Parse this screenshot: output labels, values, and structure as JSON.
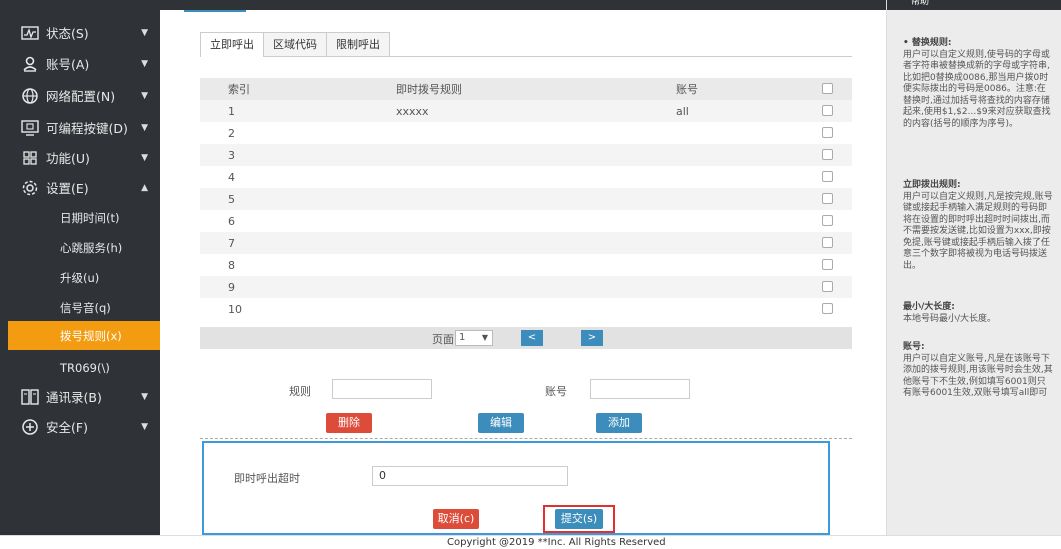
{
  "sidebar": {
    "items": [
      {
        "label": "状态(S)"
      },
      {
        "label": "账号(A)"
      },
      {
        "label": "网络配置(N)"
      },
      {
        "label": "可编程按键(D)"
      },
      {
        "label": "功能(U)"
      },
      {
        "label": "设置(E)"
      }
    ],
    "sub_items": [
      {
        "label": "日期时间(t)"
      },
      {
        "label": "心跳服务(h)"
      },
      {
        "label": "升级(u)"
      },
      {
        "label": "信号音(q)"
      },
      {
        "label": "拨号规则(x)"
      },
      {
        "label": "TR069(\\)"
      }
    ],
    "bottom_items": [
      {
        "label": "通讯录(B)"
      },
      {
        "label": "安全(F)"
      }
    ]
  },
  "tabs": [
    "立即呼出",
    "区域代码",
    "限制呼出"
  ],
  "table": {
    "headers": [
      "索引",
      "即时拨号规则",
      "账号"
    ],
    "rows": [
      {
        "index": "1",
        "rule": "xxxxx",
        "account": "all"
      },
      {
        "index": "2",
        "rule": "",
        "account": ""
      },
      {
        "index": "3",
        "rule": "",
        "account": ""
      },
      {
        "index": "4",
        "rule": "",
        "account": ""
      },
      {
        "index": "5",
        "rule": "",
        "account": ""
      },
      {
        "index": "6",
        "rule": "",
        "account": ""
      },
      {
        "index": "7",
        "rule": "",
        "account": ""
      },
      {
        "index": "8",
        "rule": "",
        "account": ""
      },
      {
        "index": "9",
        "rule": "",
        "account": ""
      },
      {
        "index": "10",
        "rule": "",
        "account": ""
      }
    ]
  },
  "pager": {
    "label": "页面",
    "selected": "1",
    "prev": "<",
    "next": ">"
  },
  "form": {
    "rule_label": "规则",
    "account_label": "账号",
    "rule_value": "",
    "account_value": "",
    "delete_label": "删除",
    "edit_label": "编辑",
    "add_label": "添加"
  },
  "timeout": {
    "label": "即时呼出超时",
    "value": "0",
    "cancel_label": "取消(c)",
    "submit_label": "提交(s)"
  },
  "help": {
    "title": "帮助",
    "blocks": [
      {
        "head": "• 替换规则:",
        "text": "用户可以自定义规则,使号码的字母或者字符串被替换成新的字母或字符串,比如把0替换成0086,那当用户拨0时便实际拨出的号码是0086。注意:在替换时,通过加括号将查找的内容存储起来,使用$1,$2...$9来对应获取查找的内容(括号的顺序为序号)。"
      },
      {
        "head": "立即拨出规则:",
        "text": "用户可以自定义规则,凡是按完规,账号键或接起手柄输入满足规则的号码即将在设置的即时呼出超时时间拨出,而不需要按发送键,比如设置为xxx,即按免提,账号键或接起手柄后输入拨了任意三个数字即将被视为电话号码拨送出。"
      },
      {
        "head": "最小/大长度:",
        "text": "本地号码最小/大长度。"
      },
      {
        "head": "账号:",
        "text": "用户可以自定义账号,凡是在该账号下添加的拨号规则,用该账号时会生效,其他账号下不生效,例如填写6001则只有账号6001生效,双账号填写all即可"
      }
    ]
  },
  "footer": "Copyright @2019 **Inc. All Rights Reserved",
  "colors": {
    "sidebar_bg": "#2f3338",
    "active_item": "#f39c12",
    "primary": "#3c8dbc",
    "danger": "#dd4b39",
    "highlight_border": "#3c9ad8"
  }
}
